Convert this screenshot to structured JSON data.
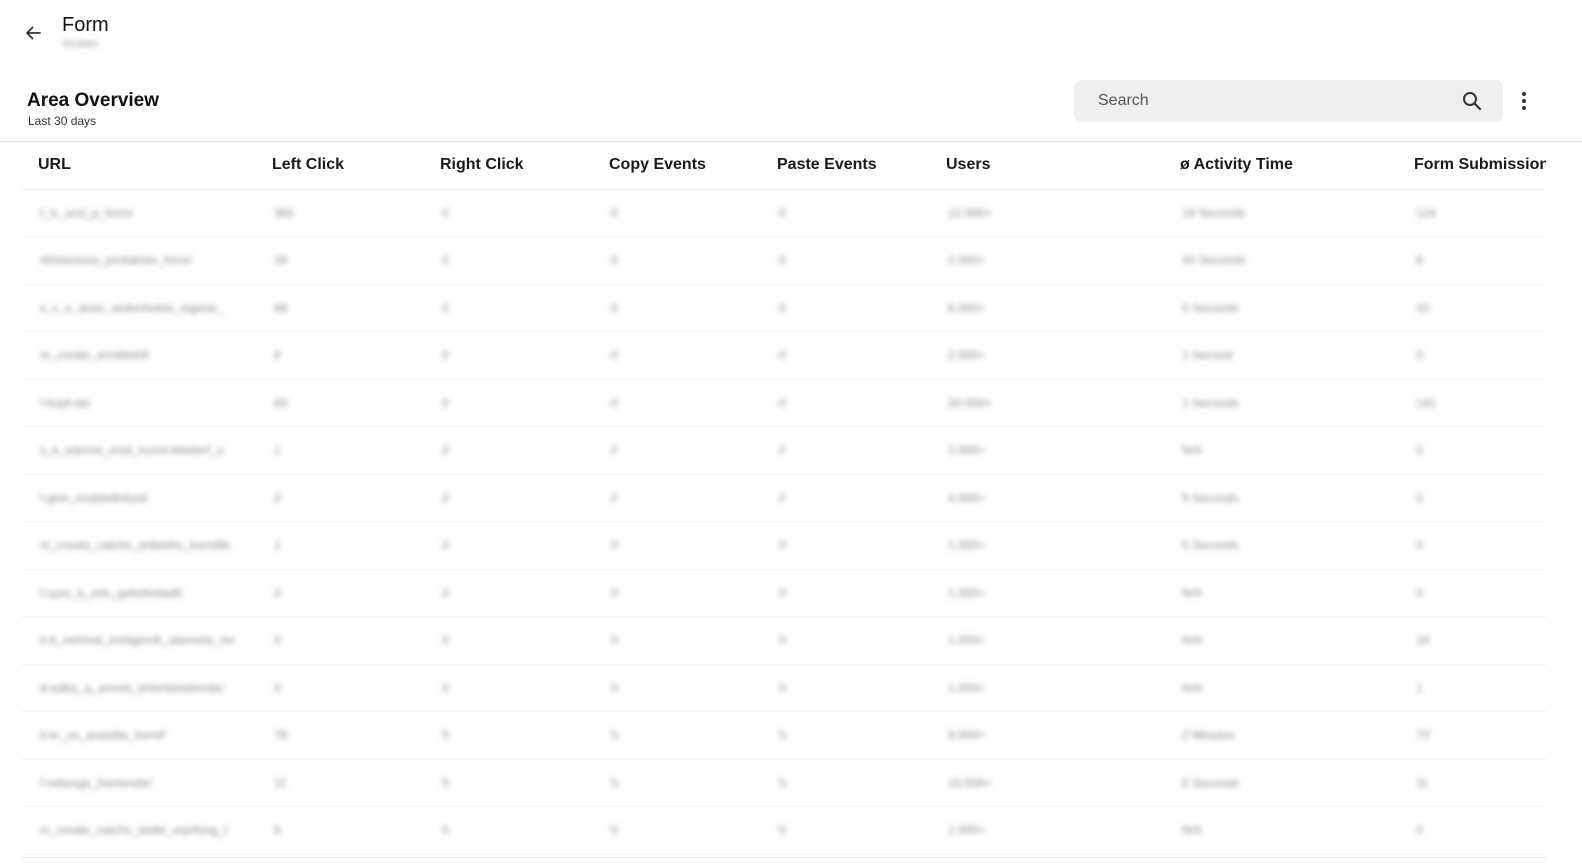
{
  "header": {
    "title": "Form",
    "subtitle": "Gruben"
  },
  "section": {
    "title": "Area Overview",
    "subtitle": "Last 30 days"
  },
  "search": {
    "placeholder": "Search",
    "value": ""
  },
  "table": {
    "columns": [
      "URL",
      "Left Click",
      "Right Click",
      "Copy Events",
      "Paste Events",
      "Users",
      "ø Activity Time",
      "Form Submissions"
    ],
    "rows": [
      [
        "f_lc_and_p_form/",
        "365",
        "0",
        "0",
        "0",
        "12.000+",
        "19 Seconds",
        "124"
      ],
      [
        "rbfxtensory_profalicke_form/",
        "28",
        "0",
        "0",
        "0",
        "2.000+",
        "43 Seconds",
        "8"
      ],
      [
        "s_c_e_anav_stufenhebte_eigene_",
        "88",
        "0",
        "0",
        "0",
        "6.000+",
        "5 Seconds",
        "10"
      ],
      [
        "m_create_ermittelnf/",
        "8",
        "0",
        "0",
        "0",
        "2.000+",
        "1 Second",
        "0"
      ],
      [
        "f-kopf-ab/",
        "83",
        "0",
        "0",
        "0",
        "20.000+",
        "1 Seconds",
        "141"
      ],
      [
        "s_k_iuterrel_orsd_kunst-kleiderf_u",
        "1",
        "0",
        "0",
        "0",
        "2.000+",
        "N/A",
        "0"
      ],
      [
        "f-give_endstellnfurd/",
        "0",
        "0",
        "0",
        "0",
        "4.000+",
        "9 Seconds",
        "0"
      ],
      [
        "m_create_catchs_anbieths_konsflik",
        "1",
        "0",
        "0",
        "0",
        "1.000+",
        "5 Seconds",
        "0"
      ],
      [
        "f-syss_k_erts_gekefestadt/",
        "0",
        "0",
        "0",
        "0",
        "1.000+",
        "N/A",
        "0"
      ],
      [
        "k-it_nehmat_ineligeruft_ubersetz_he",
        "0",
        "0",
        "0",
        "0",
        "1.000+",
        "N/A",
        "19"
      ],
      [
        "d-sdlks_a_amnet_ehlenkleiderrde/",
        "0",
        "0",
        "0",
        "0",
        "1.000+",
        "N/A",
        "1"
      ],
      [
        "k-kr_us_anstalte_formf/",
        "78",
        "0",
        "0",
        "0",
        "8.000+",
        "2 Minutes",
        "73"
      ],
      [
        "f-rebesge_fnertende/",
        "11",
        "0",
        "0",
        "0",
        "15.000+",
        "5 Seconds",
        "11"
      ],
      [
        "m_create_catchs_stelle_erprfung_f",
        "8",
        "0",
        "0",
        "0",
        "1.000+",
        "N/A",
        "0"
      ]
    ]
  },
  "icons": {
    "back": "arrow-left-icon",
    "search": "search-icon",
    "more": "more-vertical-icon"
  },
  "colors": {
    "search_bg": "#eeefef",
    "divider": "#e3e3e3",
    "text_primary": "#1a1a1a"
  }
}
